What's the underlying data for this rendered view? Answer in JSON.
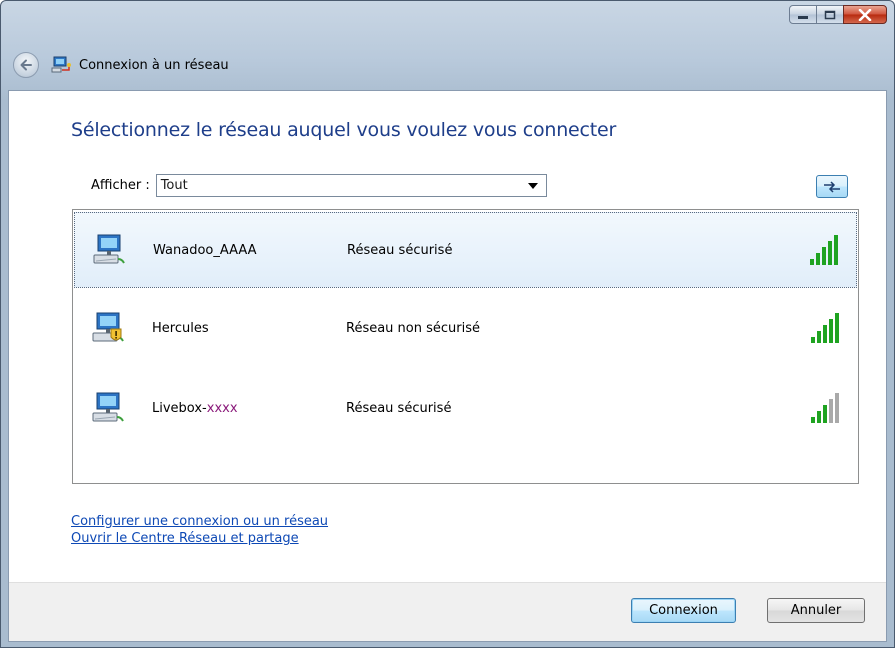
{
  "window": {
    "title": "Connexion à un réseau",
    "controls": [
      "minimize-icon",
      "maximize-icon",
      "close-icon"
    ]
  },
  "main": {
    "heading": "Sélectionnez le réseau auquel vous voulez vous connecter",
    "filter": {
      "label": "Afficher :",
      "value": "Tout"
    },
    "refresh_icon": "refresh-icon",
    "networks": [
      {
        "name": "Wanadoo_AAAA",
        "name_masked": "",
        "status": "Réseau sécurisé",
        "security": "secure",
        "signal_bars": 5,
        "selected": true
      },
      {
        "name": "Hercules",
        "name_masked": "",
        "status": "Réseau non sécurisé",
        "security": "unsecured",
        "signal_bars": 5,
        "selected": false
      },
      {
        "name": "Livebox-",
        "name_masked": "xxxx",
        "status": "Réseau sécurisé",
        "security": "secure",
        "signal_bars": 3,
        "selected": false
      }
    ],
    "links": {
      "setup": "Configurer une connexion ou un réseau",
      "network_center": "Ouvrir le Centre Réseau et partage"
    }
  },
  "footer": {
    "connect_label": "Connexion",
    "cancel_label": "Annuler"
  },
  "colors": {
    "heading": "#1e3e8a",
    "link": "#0e49b5",
    "signal_on": "#1fa321",
    "signal_off": "#a9a9a9",
    "masked_text": "#8a1a7a"
  }
}
